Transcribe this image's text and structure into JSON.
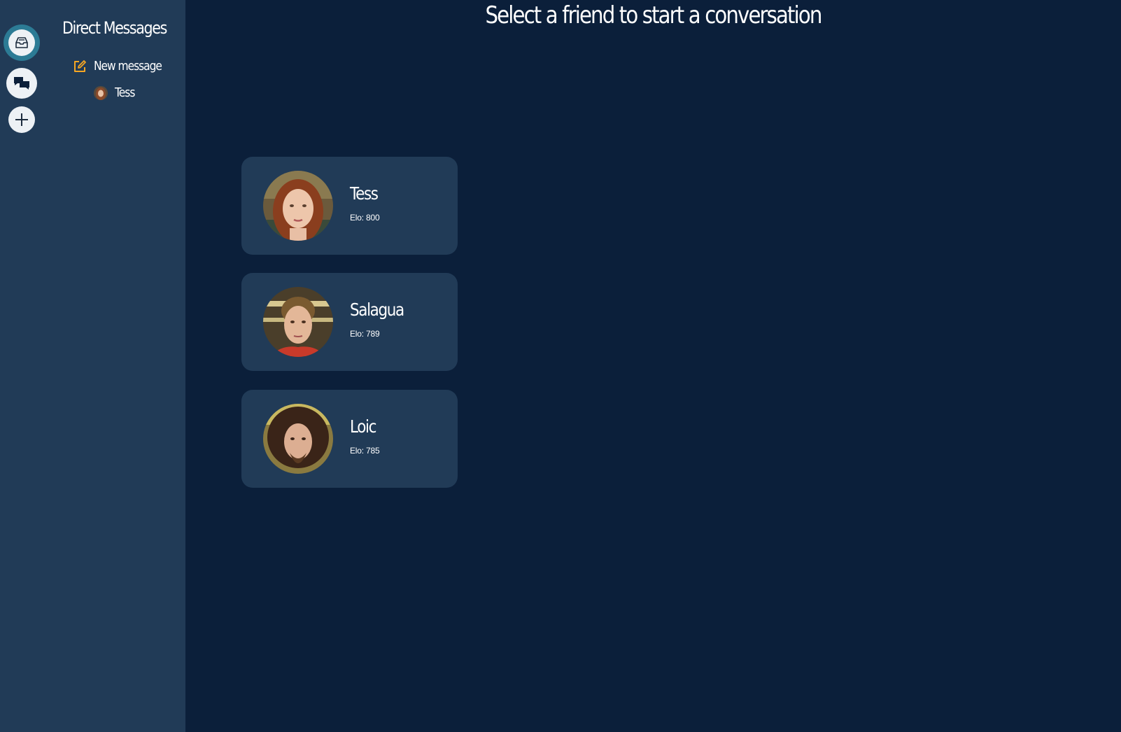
{
  "header": {
    "title": "Select a friend to start a conversation"
  },
  "rail": {
    "items": [
      {
        "icon": "inbox-icon",
        "active": true
      },
      {
        "icon": "chat-bubbles-icon",
        "active": false
      },
      {
        "icon": "plus-icon",
        "active": false
      }
    ]
  },
  "sidebar": {
    "title": "Direct Messages",
    "new_message_label": "New message",
    "conversations": [
      {
        "name": "Tess"
      }
    ]
  },
  "friends": [
    {
      "name": "Tess",
      "elo_label": "Elo:",
      "elo": "800"
    },
    {
      "name": "Salagua",
      "elo_label": "Elo:",
      "elo": "789"
    },
    {
      "name": "Loic",
      "elo_label": "Elo:",
      "elo": "785"
    }
  ],
  "colors": {
    "background": "#0b1f3a",
    "panel": "#213b57",
    "accent": "#f5a623",
    "active_ring": "#2c7b95"
  }
}
